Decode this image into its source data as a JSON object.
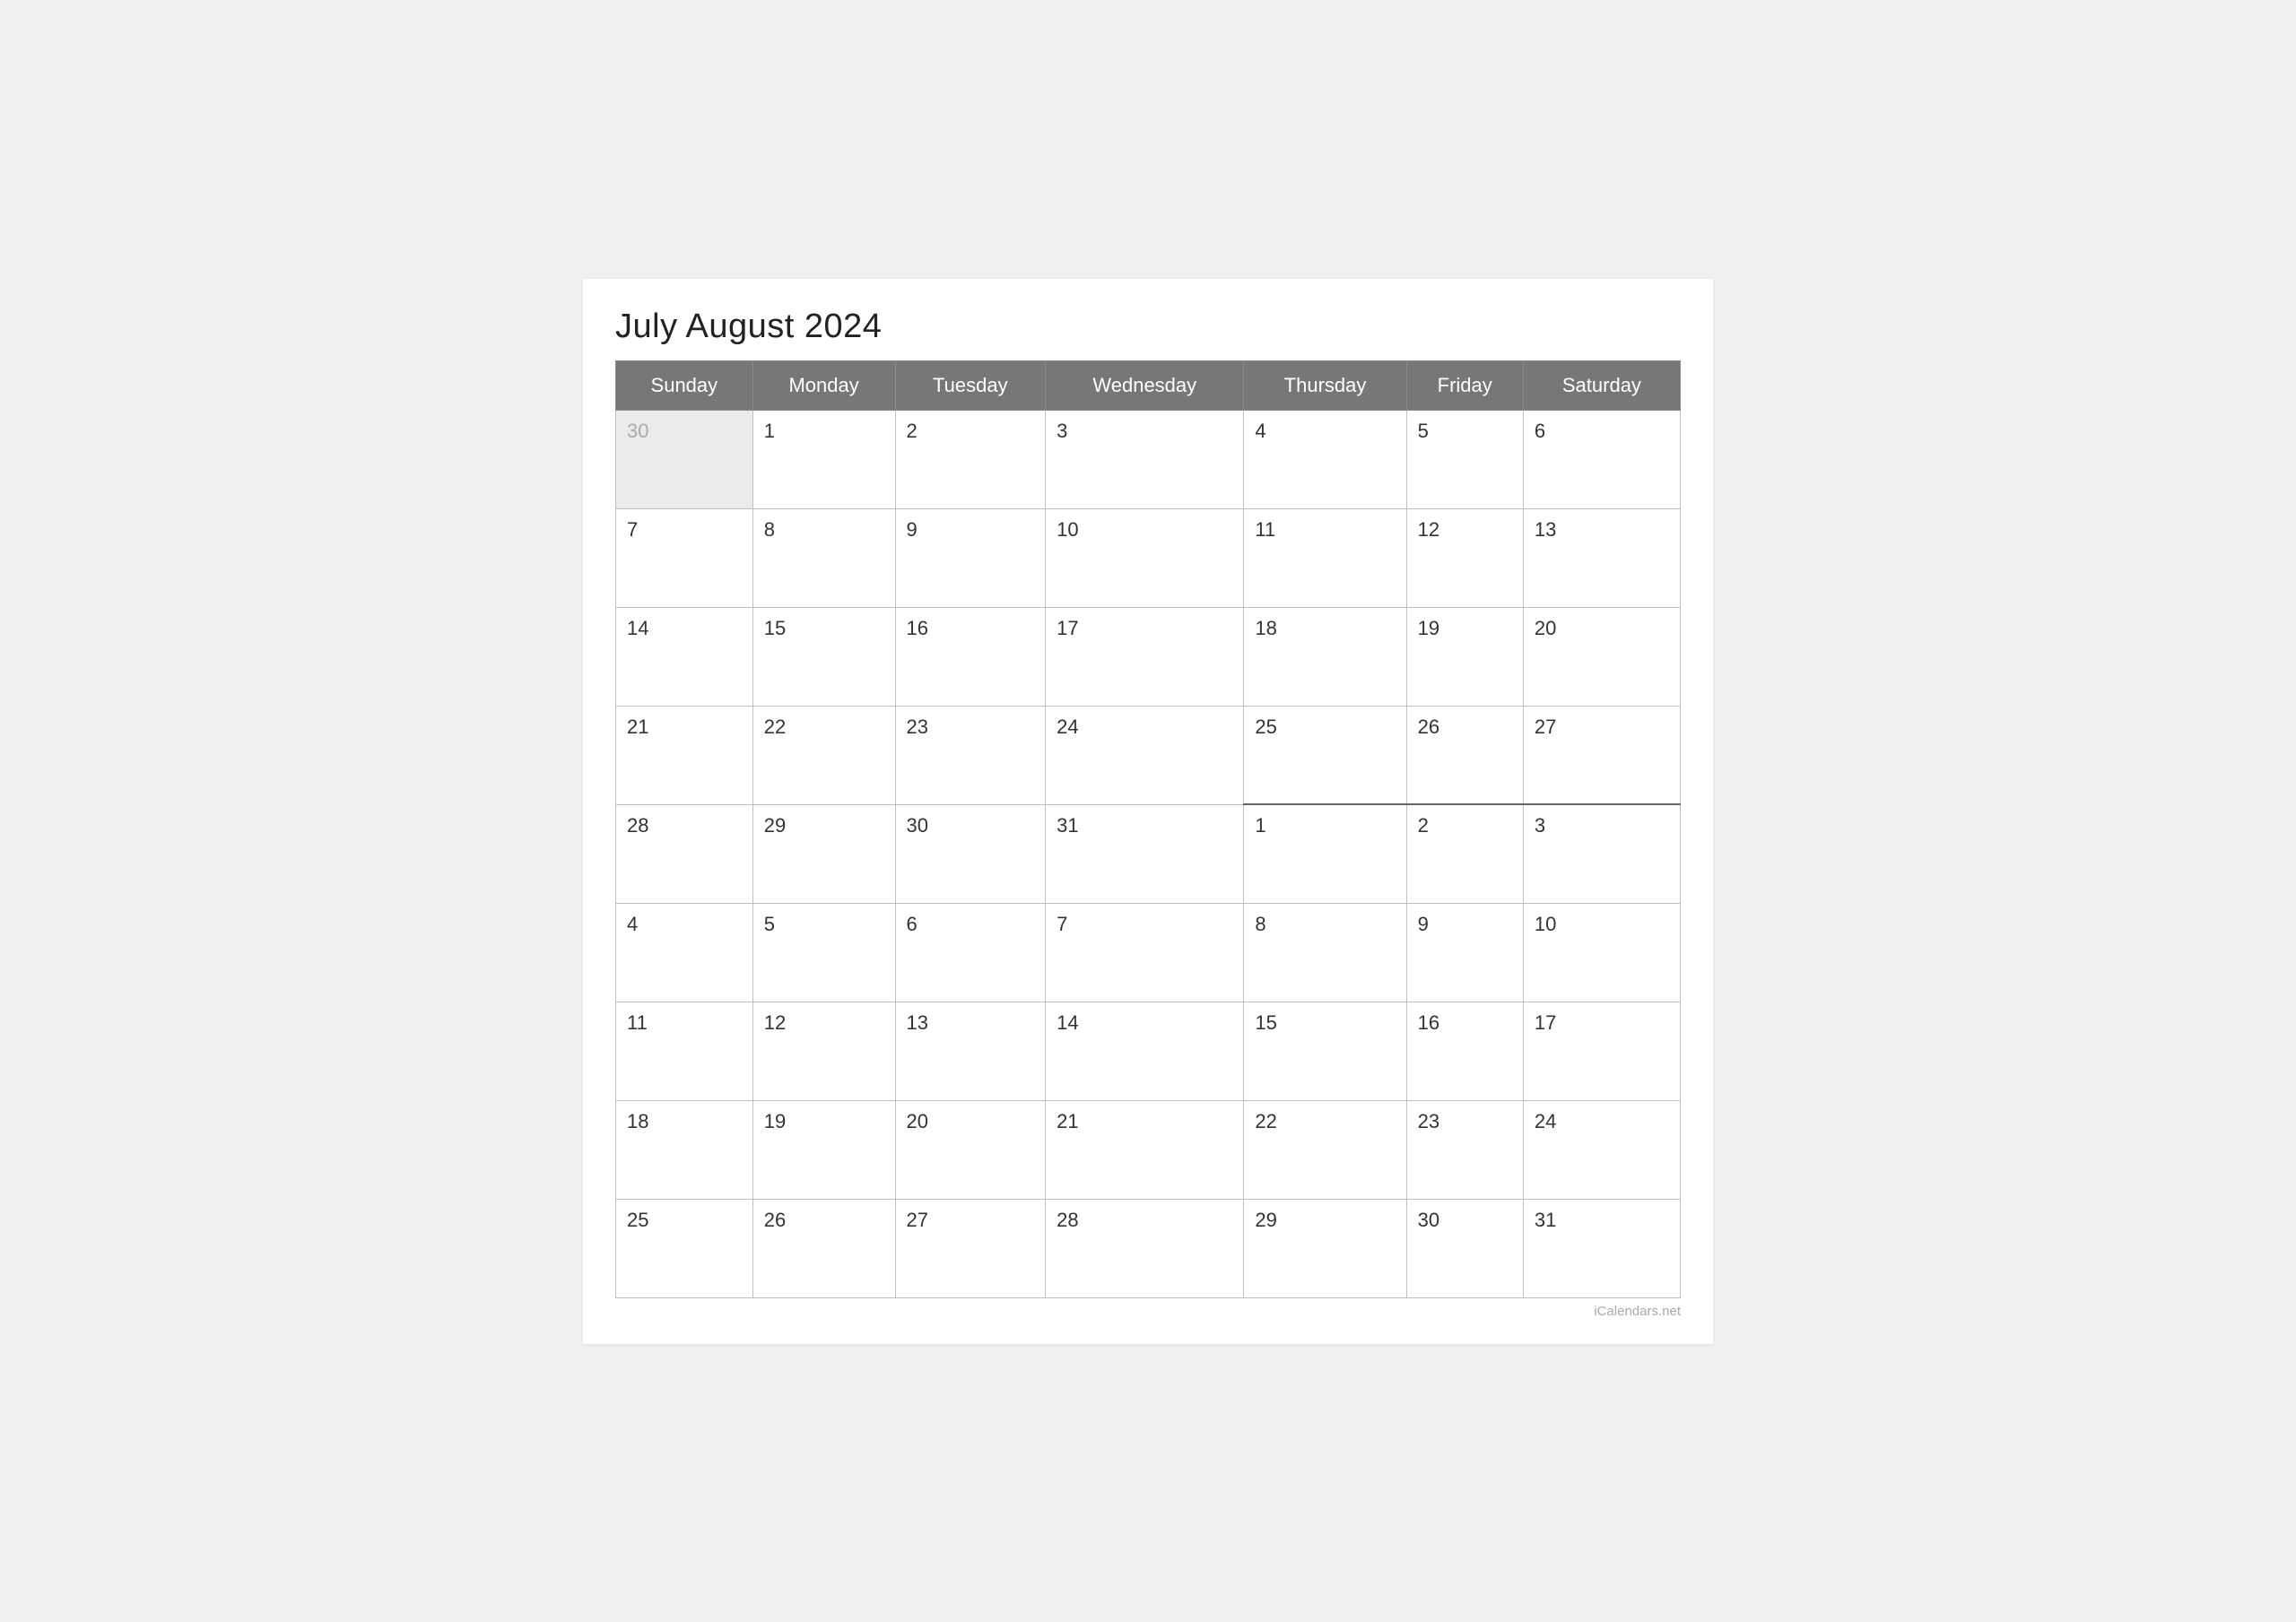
{
  "title": "July August 2024",
  "watermark": "iCalendars.net",
  "headers": [
    "Sunday",
    "Monday",
    "Tuesday",
    "Wednesday",
    "Thursday",
    "Friday",
    "Saturday"
  ],
  "weeks": [
    [
      {
        "day": "30",
        "type": "prev-month"
      },
      {
        "day": "1",
        "type": "july"
      },
      {
        "day": "2",
        "type": "july"
      },
      {
        "day": "3",
        "type": "july"
      },
      {
        "day": "4",
        "type": "july"
      },
      {
        "day": "5",
        "type": "july"
      },
      {
        "day": "6",
        "type": "july"
      }
    ],
    [
      {
        "day": "7",
        "type": "july"
      },
      {
        "day": "8",
        "type": "july"
      },
      {
        "day": "9",
        "type": "july"
      },
      {
        "day": "10",
        "type": "july"
      },
      {
        "day": "11",
        "type": "july"
      },
      {
        "day": "12",
        "type": "july"
      },
      {
        "day": "13",
        "type": "july"
      }
    ],
    [
      {
        "day": "14",
        "type": "july"
      },
      {
        "day": "15",
        "type": "july"
      },
      {
        "day": "16",
        "type": "july"
      },
      {
        "day": "17",
        "type": "july"
      },
      {
        "day": "18",
        "type": "july"
      },
      {
        "day": "19",
        "type": "july"
      },
      {
        "day": "20",
        "type": "july"
      }
    ],
    [
      {
        "day": "21",
        "type": "july"
      },
      {
        "day": "22",
        "type": "july"
      },
      {
        "day": "23",
        "type": "july"
      },
      {
        "day": "24",
        "type": "july"
      },
      {
        "day": "25",
        "type": "july"
      },
      {
        "day": "26",
        "type": "july"
      },
      {
        "day": "27",
        "type": "july"
      }
    ],
    [
      {
        "day": "28",
        "type": "july"
      },
      {
        "day": "29",
        "type": "july"
      },
      {
        "day": "30",
        "type": "july"
      },
      {
        "day": "31",
        "type": "july"
      },
      {
        "day": "1",
        "type": "august-boundary"
      },
      {
        "day": "2",
        "type": "august-boundary"
      },
      {
        "day": "3",
        "type": "august-boundary"
      }
    ],
    [
      {
        "day": "4",
        "type": "august"
      },
      {
        "day": "5",
        "type": "august"
      },
      {
        "day": "6",
        "type": "august"
      },
      {
        "day": "7",
        "type": "august"
      },
      {
        "day": "8",
        "type": "august"
      },
      {
        "day": "9",
        "type": "august"
      },
      {
        "day": "10",
        "type": "august"
      }
    ],
    [
      {
        "day": "11",
        "type": "august"
      },
      {
        "day": "12",
        "type": "august"
      },
      {
        "day": "13",
        "type": "august"
      },
      {
        "day": "14",
        "type": "august"
      },
      {
        "day": "15",
        "type": "august"
      },
      {
        "day": "16",
        "type": "august"
      },
      {
        "day": "17",
        "type": "august"
      }
    ],
    [
      {
        "day": "18",
        "type": "august"
      },
      {
        "day": "19",
        "type": "august"
      },
      {
        "day": "20",
        "type": "august"
      },
      {
        "day": "21",
        "type": "august"
      },
      {
        "day": "22",
        "type": "august"
      },
      {
        "day": "23",
        "type": "august"
      },
      {
        "day": "24",
        "type": "august"
      }
    ],
    [
      {
        "day": "25",
        "type": "august"
      },
      {
        "day": "26",
        "type": "august"
      },
      {
        "day": "27",
        "type": "august"
      },
      {
        "day": "28",
        "type": "august"
      },
      {
        "day": "29",
        "type": "august"
      },
      {
        "day": "30",
        "type": "august"
      },
      {
        "day": "31",
        "type": "august"
      }
    ]
  ]
}
